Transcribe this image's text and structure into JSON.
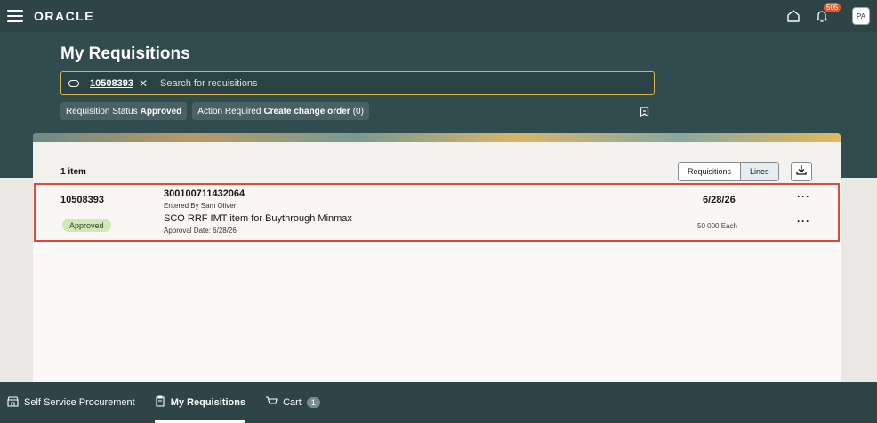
{
  "topbar": {
    "logo": "ORACLE",
    "notification_count": "505",
    "avatar_initials": "PA"
  },
  "header": {
    "title": "My Requisitions",
    "search": {
      "chip": "10508393",
      "placeholder": "Search for requisitions"
    },
    "filters": [
      {
        "label": "Requisition Status",
        "value": "Approved",
        "count": ""
      },
      {
        "label": "Action Required",
        "value": "Create change order",
        "count": "(0)"
      }
    ]
  },
  "results": {
    "count": "1 item",
    "view_toggle": {
      "requisitions": "Requisitions",
      "lines": "Lines"
    },
    "row": {
      "requisition_id": "10508393",
      "requisition_number": "300100711432064",
      "entered_by": "Entered By Sam Oliver",
      "date": "6/28/26",
      "status": "Approved",
      "item_description": "SCO RRF IMT item for Buythrough Minmax",
      "approval_date": "Approval Date: 6/28/26",
      "quantity": "50 000 Each",
      "more": "···"
    }
  },
  "bottomnav": {
    "items": [
      {
        "label": "Self Service Procurement"
      },
      {
        "label": "My Requisitions"
      },
      {
        "label": "Cart"
      }
    ],
    "cart_count": "1"
  }
}
